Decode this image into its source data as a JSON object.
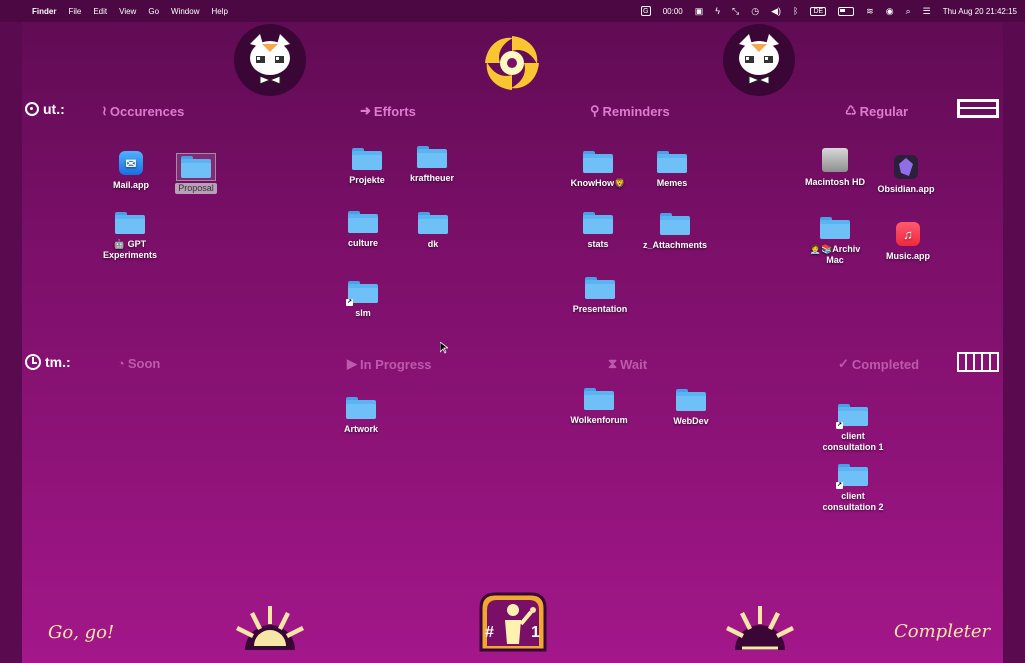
{
  "menubar": {
    "app": "Finder",
    "menus": [
      "File",
      "Edit",
      "View",
      "Go",
      "Window",
      "Help"
    ],
    "timer": "00:00",
    "input_lang": "DE",
    "datetime": "Thu Aug 20  21:42:15"
  },
  "rows": {
    "top_label": "ut.:",
    "bottom_label": "tm.:"
  },
  "sections_top": [
    {
      "icon": "≀",
      "label": "Occurences"
    },
    {
      "icon": "➜",
      "label": "Efforts"
    },
    {
      "icon": "⚲",
      "label": "Reminders"
    },
    {
      "icon": "♺",
      "label": "Regular"
    }
  ],
  "sections_bottom": [
    {
      "icon": "◔",
      "label": "Soon"
    },
    {
      "icon": "▶",
      "label": "In Progress"
    },
    {
      "icon": "⧗",
      "label": "Wait"
    },
    {
      "icon": "✓",
      "label": "Completed"
    }
  ],
  "icons": {
    "mail": "Mail.app",
    "proposal": "Proposal",
    "gpt": "🤖 GPT Experiments",
    "projekte": "Projekte",
    "kraftheuer": "kraftheuer",
    "culture": "culture",
    "dk": "dk",
    "slm": "slm",
    "knowhow": "KnowHow🦁",
    "memes": "Memes",
    "stats": "stats",
    "attachments": "z_Attachments",
    "presentation": "Presentation",
    "macintosh": "Macintosh HD",
    "obsidian": "Obsidian.app",
    "archiv": "🧑‍💼📚Archiv Mac",
    "music": "Music.app",
    "artwork": "Artwork",
    "wolkenforum": "Wolkenforum",
    "webdev": "WebDev",
    "client1": "client consultation 1",
    "client2": "client consultation 2"
  },
  "bottom": {
    "left_text": "Go, go!",
    "right_text": "Completer",
    "badge_left": "#",
    "badge_right": "1"
  }
}
